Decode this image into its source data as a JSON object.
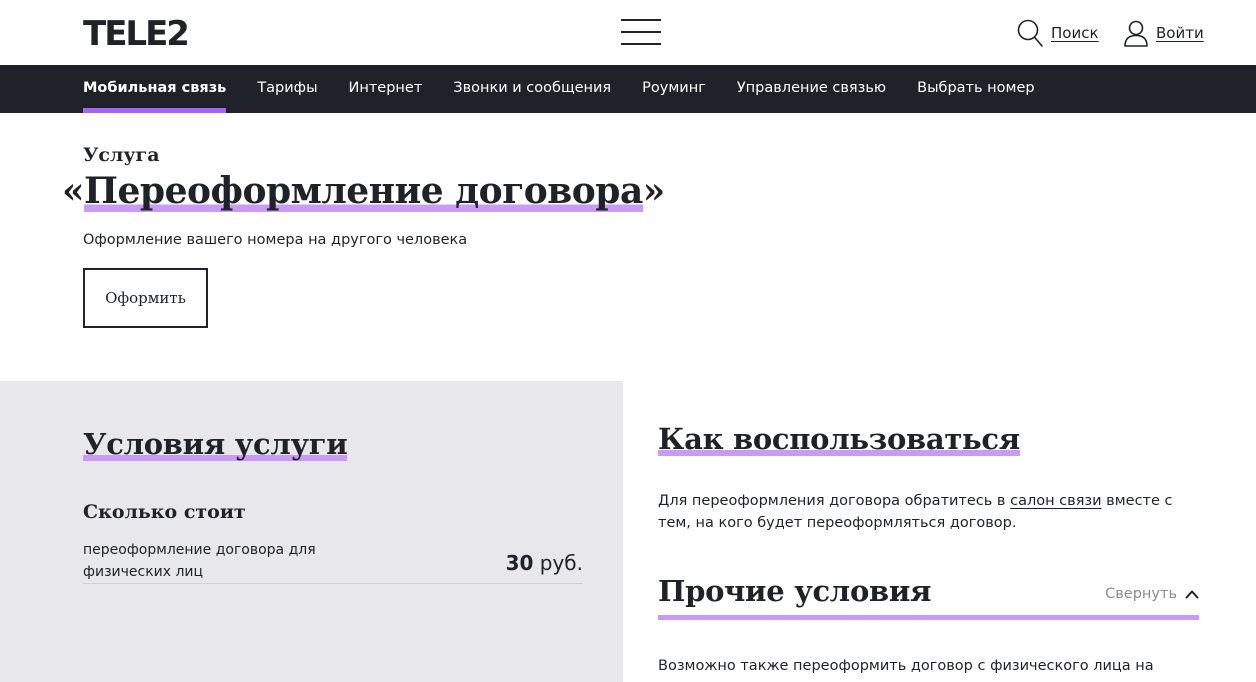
{
  "header": {
    "logo": "TELE2",
    "search_label": "Поиск",
    "login_label": "Войти"
  },
  "nav": {
    "items": [
      {
        "label": "Мобильная связь",
        "active": true
      },
      {
        "label": "Тарифы"
      },
      {
        "label": "Интернет"
      },
      {
        "label": "Звонки и сообщения"
      },
      {
        "label": "Роуминг"
      },
      {
        "label": "Управление связью"
      },
      {
        "label": "Выбрать номер"
      }
    ]
  },
  "hero": {
    "kicker": "Услуга",
    "title_open": "«",
    "title": "Переоформление договора",
    "title_close": "»",
    "subtitle": "Оформление вашего номера на другого человека",
    "button": "Оформить"
  },
  "conditions": {
    "title": "Условия услуги",
    "price_heading": "Сколько стоит",
    "price_desc": "переоформление договора для физических лиц",
    "price_value": "30",
    "price_unit": "руб."
  },
  "how": {
    "title": "Как воспользоваться",
    "text_before": "Для переоформления договора обратитесь в ",
    "link": "салон связи",
    "text_after": " вместе с тем, на кого будет переоформляться договор."
  },
  "other": {
    "title": "Прочие условия",
    "collapse_label": "Свернуть",
    "text": "Возможно также переоформить договор с физического лица на"
  },
  "colors": {
    "dark": "#1f2229",
    "accent": "#a864f0",
    "highlight": "#c99bf4",
    "panel": "#e8e8ec"
  },
  "icons": {
    "search": "search-icon",
    "user": "user-icon",
    "menu": "menu-icon",
    "chevron": "chevron-up-icon"
  }
}
